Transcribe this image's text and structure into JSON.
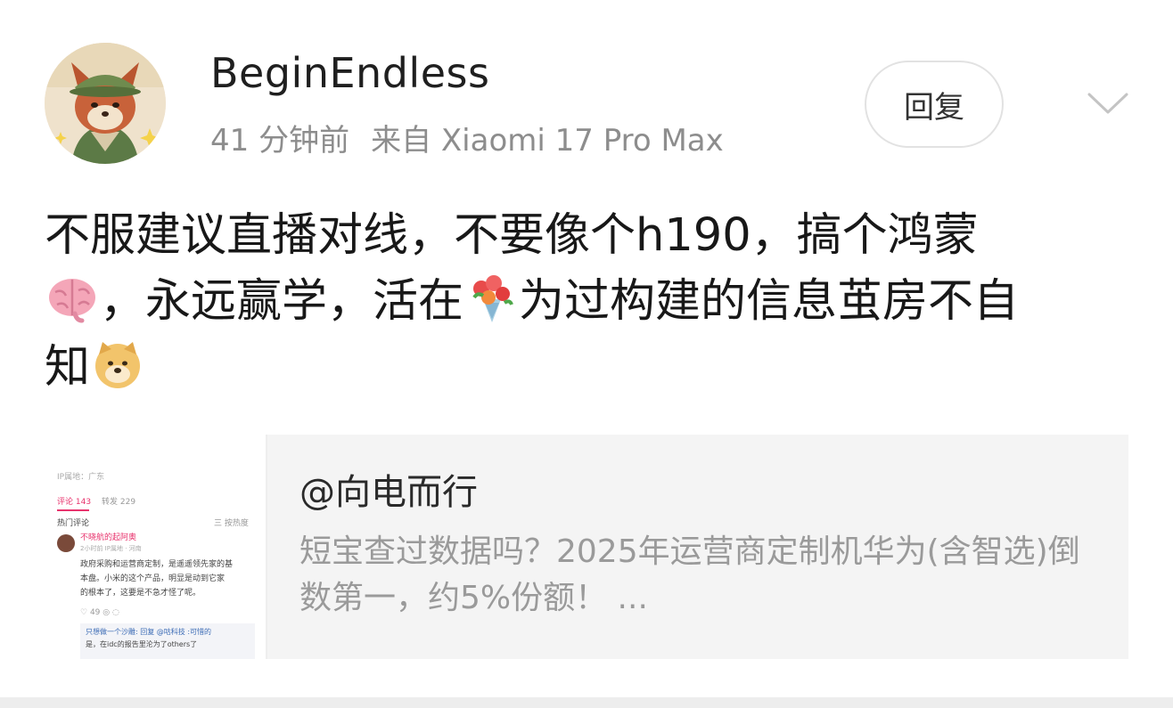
{
  "header": {
    "username": "BeginEndless",
    "time": "41 分钟前",
    "source": "来自 Xiaomi 17 Pro Max",
    "reply_label": "回复"
  },
  "post": {
    "line1": "不服建议直播对线，不要像个h190，搞个鸿蒙",
    "line2_after_brain": "，永远赢学，活在",
    "line2_after_flower": "为过构建的信息茧房不自",
    "line3": "知"
  },
  "quote": {
    "author": "@向电而行",
    "text": "短宝查过数据吗？2025年运营商定制机华为(含智选)倒数第一，约5%份额！ ...",
    "thumbnail": {
      "ip": "IP属地：广东",
      "tab_comments": "评论 143",
      "tab_reposts": "转发 229",
      "hot_label": "热门评论",
      "sort": "三 按热度",
      "commenter": "不晓航的起阿奥",
      "comment_meta": "2小时前 IP属地 · 河南",
      "comment_l1": "政府采购和运营商定制，是遥遥领先家的基",
      "comment_l2": "本盘。小米的这个产品，明显是动到它家",
      "comment_l3": "的根本了，这要是不急才怪了呢。",
      "like_count": "49",
      "reply_l1": "只想做一个沙雕: 回复 @咕科技 :可惜的",
      "reply_l2": "是，在idc的报告里沦为了others了"
    }
  },
  "colors": {
    "username": "#1f1f1f",
    "meta": "#8d8d8d",
    "card_bg": "#f4f4f4",
    "card_text": "#9a9a9a",
    "accent_pink": "#e8336d"
  },
  "icons": {
    "chevron": "chevron-down-icon",
    "brain": "brain-emoji",
    "flowers": "bouquet-emoji",
    "doge": "doge-emoji"
  }
}
